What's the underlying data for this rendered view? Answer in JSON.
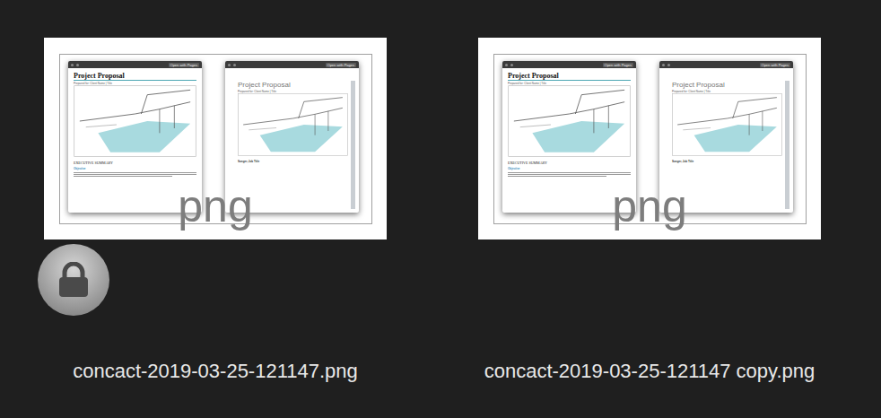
{
  "files": [
    {
      "name": "concact-2019-03-25-121147.png",
      "locked": true,
      "type_label": "png",
      "preview": {
        "windows": [
          {
            "kind": "docx",
            "button": "Open with Pages",
            "heading": "Project Proposal",
            "subtitle": "Prepared for: Client Name | Title",
            "section": "EXECUTIVE SUMMARY",
            "subheading": "Objective"
          },
          {
            "kind": "pages",
            "button": "Open with Pages",
            "heading": "Project Proposal",
            "subtitle": "Prepared for: Client Name | Title",
            "footer": "Songer, Job Title"
          }
        ]
      }
    },
    {
      "name": "concact-2019-03-25-121147 copy.png",
      "locked": false,
      "type_label": "png",
      "preview": {
        "windows": [
          {
            "kind": "docx",
            "button": "Open with Pages",
            "heading": "Project Proposal",
            "subtitle": "Prepared for: Client Name | Title",
            "section": "EXECUTIVE SUMMARY",
            "subheading": "Objective"
          },
          {
            "kind": "pages",
            "button": "Open with Pages",
            "heading": "Project Proposal",
            "subtitle": "Prepared for: Client Name | Title",
            "footer": "Songer, Job Title"
          }
        ]
      }
    }
  ]
}
